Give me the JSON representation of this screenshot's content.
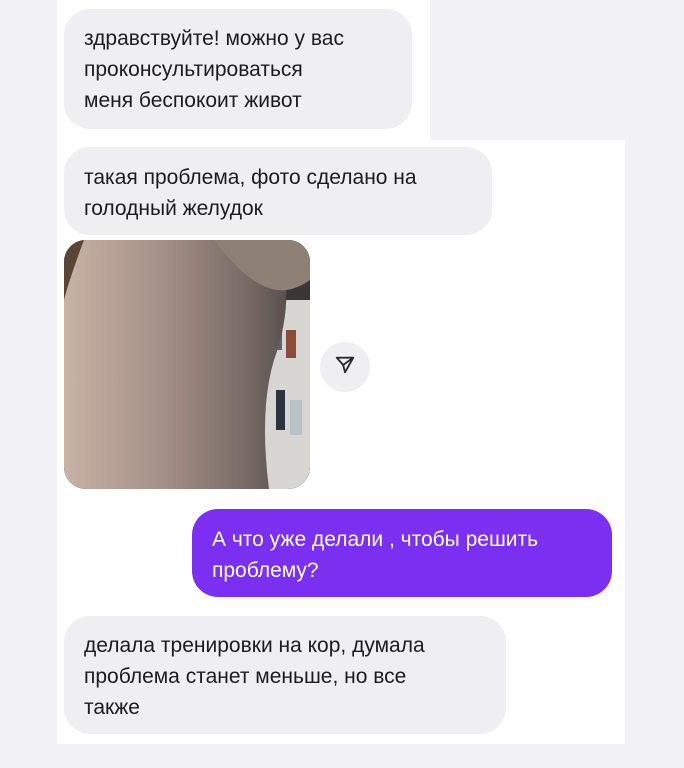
{
  "messages": [
    {
      "from": "them",
      "lines": [
        "здравствуйте! можно у вас",
        "проконсультироваться",
        "меня беспокоит живот"
      ]
    },
    {
      "from": "them",
      "lines": [
        "такая проблема, фото сделано на",
        "голодный желудок"
      ]
    },
    {
      "from": "me",
      "lines": [
        "А что уже делали , чтобы решить",
        "проблему?"
      ]
    },
    {
      "from": "them",
      "lines": [
        "делала тренировки на кор, думала",
        "проблема станет меньше, но все",
        "также"
      ]
    }
  ],
  "attachment": {
    "type": "photo",
    "share_icon": "send-arrow-icon"
  },
  "colors": {
    "incoming_bubble": "#efeff2",
    "outgoing_bubble": "#7b2ff1",
    "background": "#f2f2f4"
  }
}
